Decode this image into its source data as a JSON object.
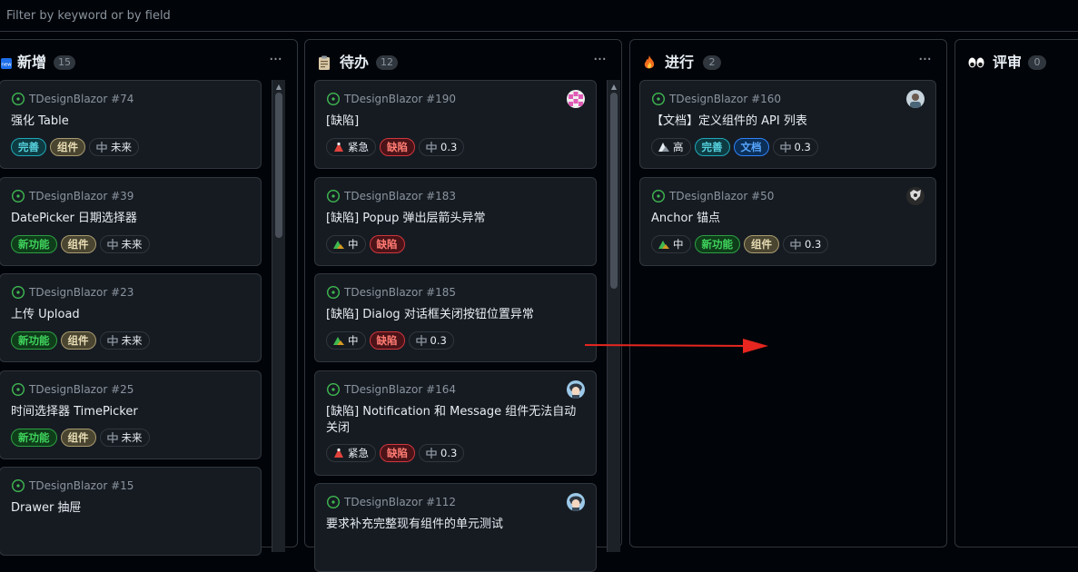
{
  "filter": {
    "placeholder": "Filter by keyword or by field"
  },
  "colors": {
    "accent_green": "#3fb950",
    "card_bg": "#161b22",
    "border": "#30363d",
    "arrow": "#e6261f"
  },
  "columns": [
    {
      "title": "新增",
      "count": "15",
      "icon": "new-icon",
      "cards": [
        {
          "repo": "TDesignBlazor #74",
          "title": "强化 Table",
          "labels": [
            {
              "text": "完善"
            },
            {
              "text": "组件"
            },
            {
              "text": "未来",
              "icon": "iteration-icon"
            }
          ]
        },
        {
          "repo": "TDesignBlazor #39",
          "title": "DatePicker 日期选择器",
          "labels": [
            {
              "text": "新功能"
            },
            {
              "text": "组件"
            },
            {
              "text": "未来",
              "icon": "iteration-icon"
            }
          ]
        },
        {
          "repo": "TDesignBlazor #23",
          "title": "上传 Upload",
          "labels": [
            {
              "text": "新功能"
            },
            {
              "text": "组件"
            },
            {
              "text": "未来",
              "icon": "iteration-icon"
            }
          ]
        },
        {
          "repo": "TDesignBlazor #25",
          "title": "时间选择器 TimePicker",
          "labels": [
            {
              "text": "新功能"
            },
            {
              "text": "组件"
            },
            {
              "text": "未来",
              "icon": "iteration-icon"
            }
          ]
        },
        {
          "repo": "TDesignBlazor #15",
          "title": "Drawer 抽屉",
          "labels": []
        }
      ]
    },
    {
      "title": "待办",
      "count": "12",
      "icon": "clipboard-icon",
      "cards": [
        {
          "repo": "TDesignBlazor #190",
          "title": "[缺陷]",
          "avatar": "pink-identicon-avatar",
          "labels": [
            {
              "text": "紧急",
              "icon": "urgent-icon"
            },
            {
              "text": "缺陷"
            },
            {
              "text": "0.3",
              "icon": "iteration-icon"
            }
          ]
        },
        {
          "repo": "TDesignBlazor #183",
          "title": "[缺陷] Popup 弹出层箭头异常",
          "labels": [
            {
              "text": "中",
              "icon": "medium-icon"
            },
            {
              "text": "缺陷"
            }
          ]
        },
        {
          "repo": "TDesignBlazor #185",
          "title": "[缺陷] Dialog 对话框关闭按钮位置异常",
          "labels": [
            {
              "text": "中",
              "icon": "medium-icon"
            },
            {
              "text": "缺陷"
            },
            {
              "text": "0.3",
              "icon": "iteration-icon"
            }
          ]
        },
        {
          "repo": "TDesignBlazor #164",
          "title": "[缺陷] Notification 和 Message 组件无法自动关闭",
          "avatar": "anime-avatar",
          "labels": [
            {
              "text": "紧急",
              "icon": "urgent-icon"
            },
            {
              "text": "缺陷"
            },
            {
              "text": "0.3",
              "icon": "iteration-icon"
            }
          ]
        },
        {
          "repo": "TDesignBlazor #112",
          "title": "要求补充完整现有组件的单元测试",
          "avatar": "anime-avatar",
          "labels": []
        }
      ]
    },
    {
      "title": "进行",
      "count": "2",
      "icon": "fire-icon",
      "cards": [
        {
          "repo": "TDesignBlazor #160",
          "title": "【文档】定义组件的 API 列表",
          "avatar": "photo-avatar",
          "labels": [
            {
              "text": "高",
              "icon": "high-icon"
            },
            {
              "text": "完善"
            },
            {
              "text": "文档"
            },
            {
              "text": "0.3",
              "icon": "iteration-icon"
            }
          ]
        },
        {
          "repo": "TDesignBlazor #50",
          "title": "Anchor 锚点",
          "avatar": "dark-avatar",
          "labels": [
            {
              "text": "中",
              "icon": "medium-icon"
            },
            {
              "text": "新功能"
            },
            {
              "text": "组件"
            },
            {
              "text": "0.3",
              "icon": "iteration-icon"
            }
          ]
        }
      ]
    },
    {
      "title": "评审",
      "count": "0",
      "icon": "eyes-icon",
      "cards": []
    }
  ]
}
